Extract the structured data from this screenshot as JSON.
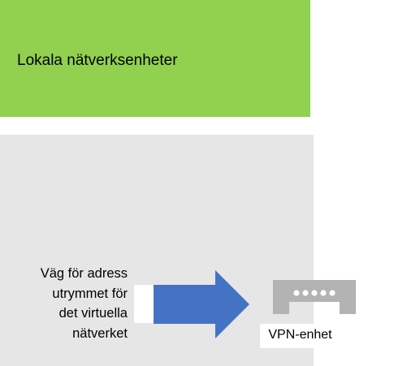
{
  "colors": {
    "local_box": "#92d050",
    "vnet_box": "#e6e6e6",
    "arrow": "#4472c4",
    "vpn_device": "#b3b3b3"
  },
  "local_network": {
    "label": "Lokala nätverksenheter"
  },
  "route": {
    "lines": [
      "Väg för adress",
      "utrymmet för",
      "det virtuella",
      "nätverket"
    ]
  },
  "vpn_device": {
    "icon": "vpn-gateway-icon",
    "label": "VPN-enhet"
  }
}
